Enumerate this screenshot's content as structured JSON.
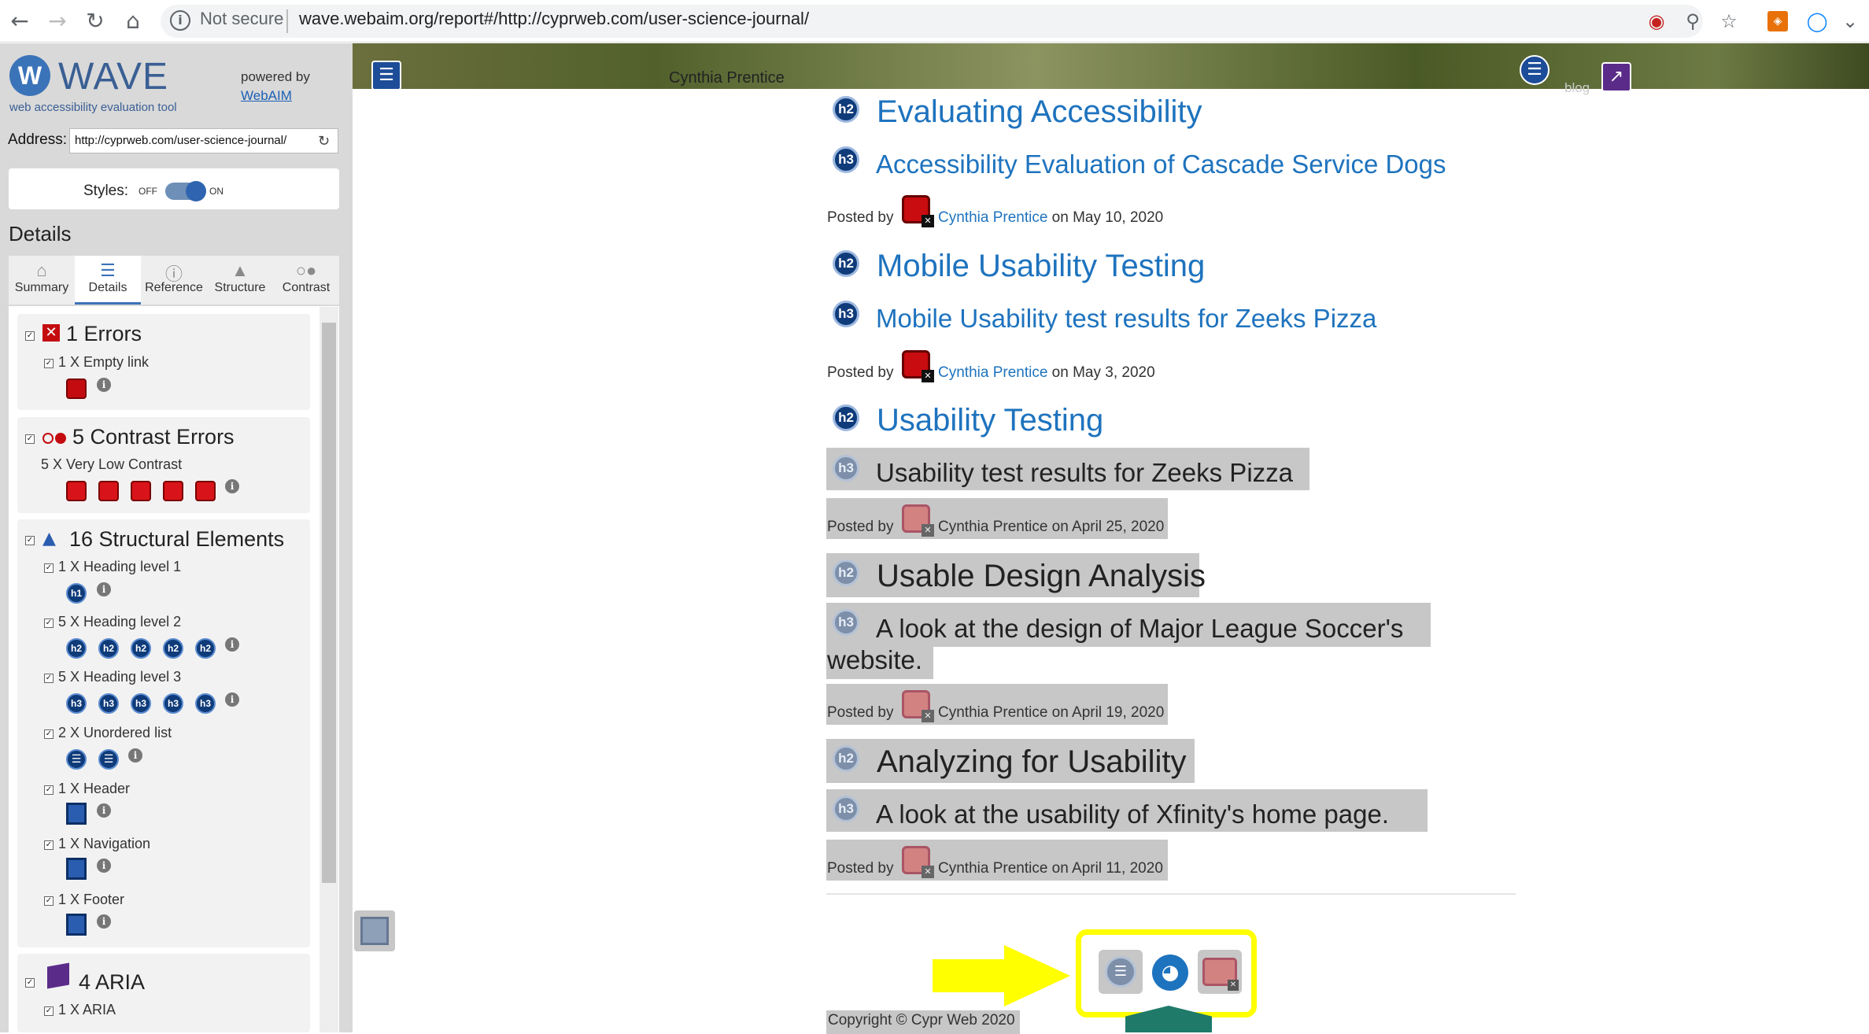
{
  "browser": {
    "security_label": "Not secure",
    "url": "wave.webaim.org/report#/http://cyprweb.com/user-science-journal/"
  },
  "wave": {
    "logo_text": "WAVE",
    "logo_letter": "W",
    "tagline": "web accessibility evaluation tool",
    "powered_by": "powered by",
    "webaim_link": "WebAIM",
    "address_label": "Address:",
    "address_value": "http://cyprweb.com/user-science-journal/",
    "styles_label": "Styles:",
    "toggle_off": "OFF",
    "toggle_on": "ON",
    "details_heading": "Details",
    "tabs": [
      {
        "label": "Summary",
        "icon": "home-icon"
      },
      {
        "label": "Details",
        "icon": "list-icon"
      },
      {
        "label": "Reference",
        "icon": "info-icon"
      },
      {
        "label": "Structure",
        "icon": "structure-icon"
      },
      {
        "label": "Contrast",
        "icon": "contrast-icon"
      }
    ],
    "categories": {
      "errors": {
        "title": "1 Errors",
        "items": [
          {
            "label": "1 X Empty link"
          }
        ]
      },
      "contrast": {
        "title": "5 Contrast Errors",
        "items": [
          {
            "label": "5 X Very Low Contrast"
          }
        ]
      },
      "structural": {
        "title": "16 Structural Elements",
        "items": [
          {
            "label": "1 X Heading level 1",
            "badges": [
              "h1"
            ]
          },
          {
            "label": "5 X Heading level 2",
            "badges": [
              "h2",
              "h2",
              "h2",
              "h2",
              "h2"
            ]
          },
          {
            "label": "5 X Heading level 3",
            "badges": [
              "h3",
              "h3",
              "h3",
              "h3",
              "h3"
            ]
          },
          {
            "label": "2 X Unordered list"
          },
          {
            "label": "1 X Header"
          },
          {
            "label": "1 X Navigation"
          },
          {
            "label": "1 X Footer"
          }
        ]
      },
      "aria": {
        "title": "4 ARIA",
        "items": [
          {
            "label": "1 X ARIA"
          }
        ]
      }
    }
  },
  "page": {
    "hero_author": "Cynthia Prentice",
    "hero_blog": "blog",
    "posts": [
      {
        "h2": "Evaluating Accessibility",
        "h3": "Accessibility Evaluation of Cascade Service Dogs",
        "posted_by": "Posted by",
        "author": "Cynthia Prentice",
        "date": " on May 10, 2020"
      },
      {
        "h2": "Mobile Usability Testing",
        "h3": "Mobile Usability test results for Zeeks Pizza",
        "posted_by": "Posted by",
        "author": "Cynthia Prentice",
        "date": " on May 3, 2020"
      },
      {
        "h2": "Usability Testing",
        "h3": "Usability test results for Zeeks Pizza",
        "posted_by": "Posted by",
        "author": "Cynthia Prentice",
        "date": " on April 25, 2020"
      },
      {
        "h2": "Usable Design Analysis",
        "h3_line1": "A look at the design of Major League Soccer's",
        "h3_line2": "website.",
        "posted_by": "Posted by",
        "author": "Cynthia Prentice",
        "date": " on April 19, 2020"
      },
      {
        "h2": "Analyzing for Usability",
        "h3": "A look at the usability of Xfinity's home page.",
        "posted_by": "Posted by",
        "author": "Cynthia Prentice",
        "date": " on April 11, 2020"
      }
    ],
    "copyright": "Copyright © Cypr Web 2020"
  },
  "colors": {
    "accent": "#1e73be",
    "wave_blue": "#3b73b8",
    "error_red": "#c40c10",
    "highlight_yellow": "#ffff00",
    "contrast_gray": "#c7c7c7"
  }
}
